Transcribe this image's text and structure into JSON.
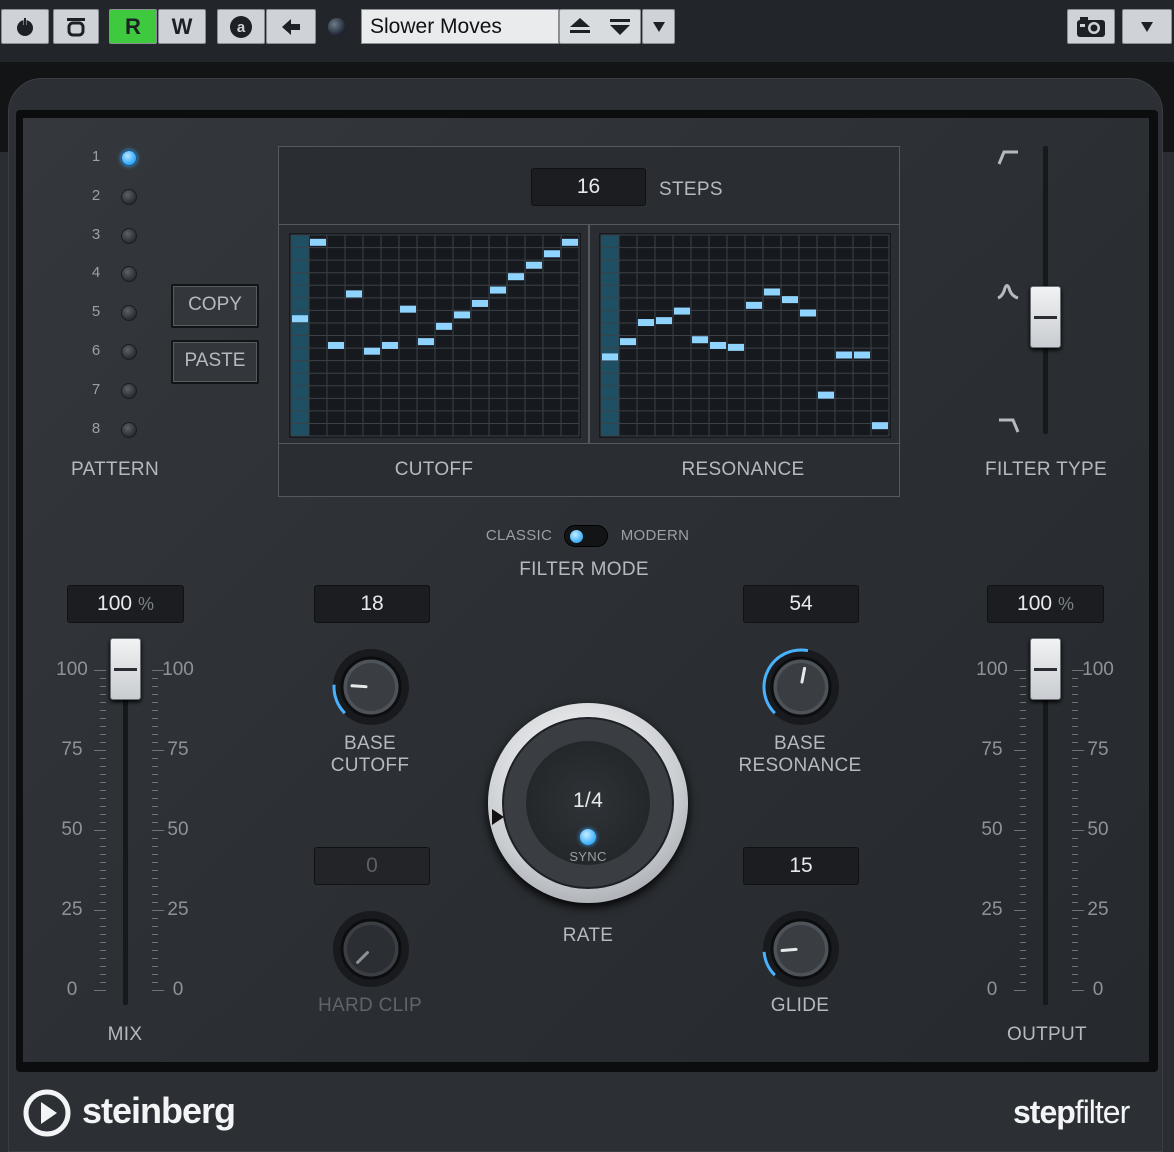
{
  "toolbar": {
    "power_icon": "power-icon",
    "bypass_icon": "bypass-icon",
    "read_label": "R",
    "write_label": "W",
    "auto_icon": "a-icon",
    "prev_icon": "arrow-left-icon",
    "preset_name": "Slower Moves",
    "load_icon": "preset-load-icon",
    "save_icon": "preset-save-icon",
    "menu_icon": "triangle-down-icon",
    "camera_icon": "camera-icon",
    "colors": {
      "read_active": "#3ec93e"
    }
  },
  "pattern": {
    "label": "PATTERN",
    "numbers": [
      "1",
      "2",
      "3",
      "4",
      "5",
      "6",
      "7",
      "8"
    ],
    "selected": "1",
    "copy_label": "COPY",
    "paste_label": "PASTE"
  },
  "steps": {
    "value": "16",
    "label": "STEPS"
  },
  "grid": {
    "cutoff_label": "CUTOFF",
    "resonance_label": "RESONANCE",
    "cutoff_steps": [
      0.58,
      0.98,
      0.44,
      0.71,
      0.41,
      0.44,
      0.63,
      0.46,
      0.54,
      0.6,
      0.66,
      0.73,
      0.8,
      0.86,
      0.92,
      0.98
    ],
    "resonance_steps": [
      0.38,
      0.46,
      0.56,
      0.57,
      0.62,
      0.47,
      0.44,
      0.43,
      0.65,
      0.72,
      0.68,
      0.61,
      0.18,
      0.39,
      0.39,
      0.02
    ],
    "colors": {
      "step": "#8fd3ff",
      "grid_bg": "#161a1e"
    }
  },
  "filter_type": {
    "label": "FILTER TYPE",
    "icons": [
      "highpass-icon",
      "bandpass-icon",
      "lowpass-icon"
    ],
    "position": 0.55
  },
  "filter_mode": {
    "classic_label": "CLASSIC",
    "modern_label": "MODERN",
    "label": "FILTER MODE"
  },
  "mix": {
    "value": "100",
    "unit": "%",
    "label": "MIX",
    "scale": [
      "100",
      "75",
      "50",
      "25",
      "0"
    ]
  },
  "output": {
    "value": "100",
    "unit": "%",
    "label": "OUTPUT",
    "scale": [
      "100",
      "75",
      "50",
      "25",
      "0"
    ]
  },
  "base_cutoff": {
    "value": "18",
    "label1": "BASE",
    "label2": "CUTOFF",
    "level": 0.18
  },
  "base_resonance": {
    "value": "54",
    "label1": "BASE",
    "label2": "RESONANCE",
    "level": 0.54
  },
  "hard_clip": {
    "value": "0",
    "label": "HARD CLIP",
    "level": 0
  },
  "glide": {
    "value": "15",
    "label": "GLIDE",
    "level": 0.15
  },
  "rate": {
    "value": "1/4",
    "sync_label": "SYNC",
    "label": "RATE"
  },
  "footer": {
    "brand": "steinberg",
    "product_bold": "step",
    "product_light": "filter"
  }
}
